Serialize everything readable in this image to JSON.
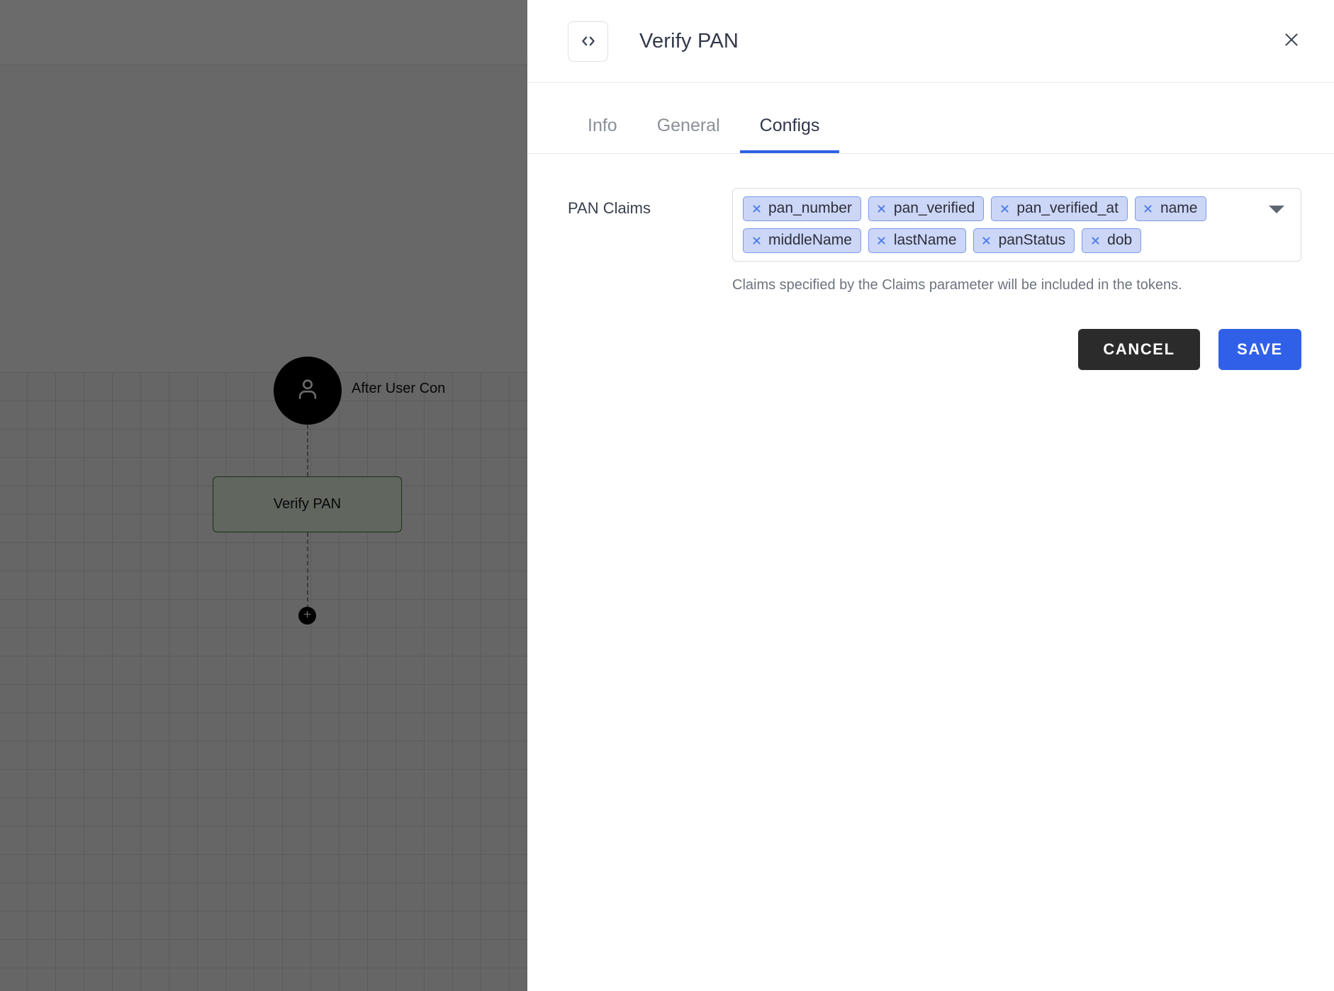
{
  "canvas": {
    "user_node": {
      "icon": "user-icon",
      "label": "After User Con"
    },
    "action_node": {
      "label": "Verify PAN"
    },
    "add_button": {
      "icon": "plus-icon"
    }
  },
  "panel": {
    "icon": "code-brackets-icon",
    "title": "Verify PAN",
    "close_icon": "close-icon",
    "tabs": [
      {
        "label": "Info",
        "active": false
      },
      {
        "label": "General",
        "active": false
      },
      {
        "label": "Configs",
        "active": true
      }
    ],
    "form": {
      "field_label": "PAN Claims",
      "chips": [
        {
          "label": "pan_number"
        },
        {
          "label": "pan_verified"
        },
        {
          "label": "pan_verified_at"
        },
        {
          "label": "name"
        },
        {
          "label": "middleName"
        },
        {
          "label": "lastName"
        },
        {
          "label": "panStatus"
        },
        {
          "label": "dob"
        }
      ],
      "dropdown_icon": "chevron-down-icon",
      "help_text": "Claims specified by the Claims parameter will be included in the tokens."
    },
    "actions": {
      "cancel_label": "CANCEL",
      "save_label": "SAVE"
    }
  },
  "colors": {
    "accent_blue": "#3160e8",
    "tab_underline": "#2f5fe8",
    "chip_bg": "#ccd6f6",
    "chip_border": "#7b9ae8",
    "chip_x": "#4b7bec",
    "cancel_bg": "#2b2b2b",
    "node_border_green": "#3f7a35"
  }
}
